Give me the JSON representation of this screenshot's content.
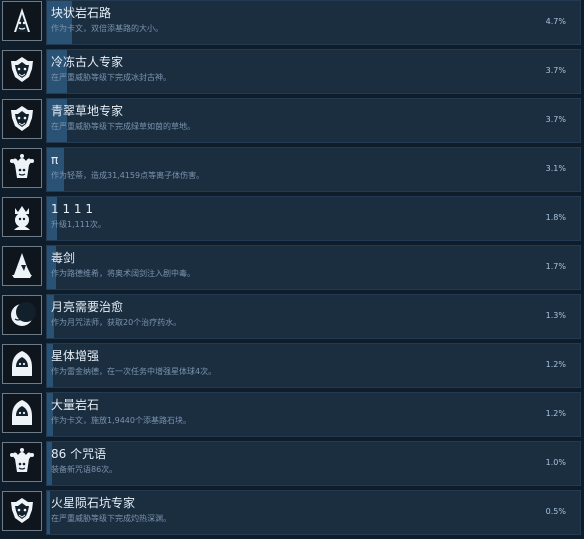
{
  "achievements": [
    {
      "title": "块状岩石路",
      "description": "作为卡文，双倍添基路的大小。",
      "percent": "4.7%",
      "icon": "tiki-mask-icon",
      "progress": 0.047
    },
    {
      "title": "冷冻古人专家",
      "description": "在严重威胁等级下完成冰封古神。",
      "percent": "3.7%",
      "icon": "ornate-mask-icon",
      "progress": 0.037
    },
    {
      "title": "青翠草地专家",
      "description": "在严重威胁等级下完成绿草如茵的草地。",
      "percent": "3.7%",
      "icon": "ornate-mask-icon",
      "progress": 0.037
    },
    {
      "title": "π",
      "description": "作为轻蒂，造成31,4159点等离子体伤害。",
      "percent": "3.1%",
      "icon": "jester-icon",
      "progress": 0.031
    },
    {
      "title": "1 1 1 1",
      "description": "升级1,111次。",
      "percent": "1.8%",
      "icon": "crowned-head-icon",
      "progress": 0.018
    },
    {
      "title": "毒剑",
      "description": "作为路德维希，将奥术阔剑注入剧中毒。",
      "percent": "1.7%",
      "icon": "wizard-hat-icon",
      "progress": 0.017
    },
    {
      "title": "月亮需要治愈",
      "description": "作为月咒法师，获取20个治疗药水。",
      "percent": "1.3%",
      "icon": "crescent-moon-icon",
      "progress": 0.013
    },
    {
      "title": "星体增强",
      "description": "作为雷金纳德，在一次任务中增强星体球4次。",
      "percent": "1.2%",
      "icon": "hooded-figure-icon",
      "progress": 0.012
    },
    {
      "title": "大量岩石",
      "description": "作为卡文，施放1,9440个添基路石块。",
      "percent": "1.2%",
      "icon": "hooded-figure-icon",
      "progress": 0.012
    },
    {
      "title": "86 个咒语",
      "description": "装备新咒语86次。",
      "percent": "1.0%",
      "icon": "jester-icon",
      "progress": 0.01
    },
    {
      "title": "火星陨石坑专家",
      "description": "在严重威胁等级下完成灼热深渊。",
      "percent": "0.5%",
      "icon": "ornate-mask-icon",
      "progress": 0.005
    }
  ]
}
